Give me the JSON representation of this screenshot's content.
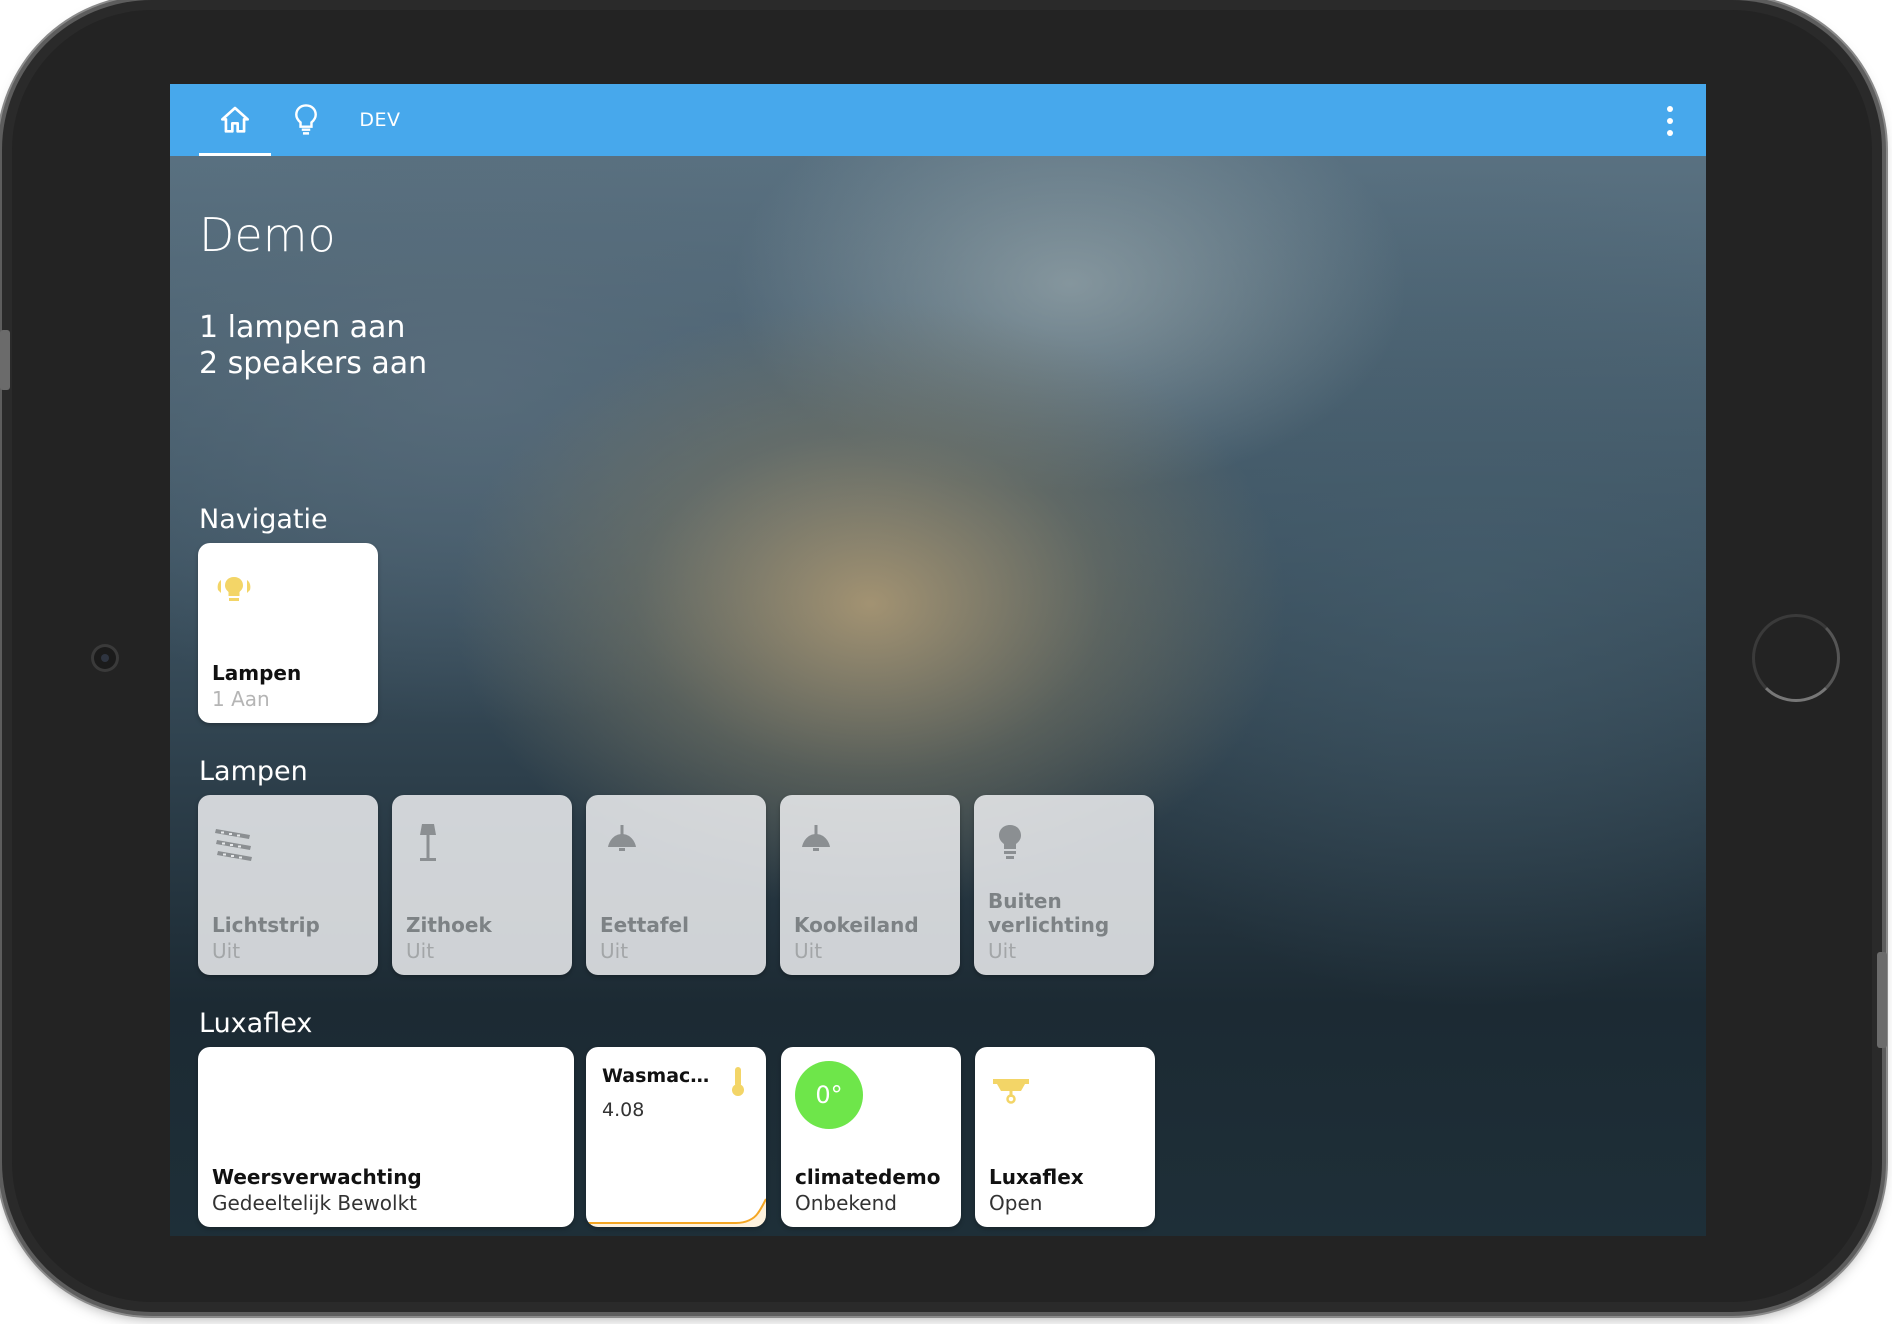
{
  "header": {
    "tabs": [
      {
        "icon": "home-icon",
        "active": true
      },
      {
        "icon": "lightbulb-icon",
        "active": false
      },
      {
        "label": "DEV",
        "active": false
      }
    ],
    "menu_icon": "kebab-menu-icon",
    "accent_color": "#47a8ec"
  },
  "page": {
    "title": "Demo",
    "summary": [
      "1 lampen aan",
      "2 speakers aan"
    ]
  },
  "sections": {
    "navigatie": {
      "title": "Navigatie",
      "cards": [
        {
          "name": "Lampen",
          "state": "1 Aan",
          "icon": "lightbulb-group-icon",
          "icon_color": "#f3d567"
        }
      ]
    },
    "lampen": {
      "title": "Lampen",
      "cards": [
        {
          "name": "Lichtstrip",
          "state": "Uit",
          "icon": "led-strip-icon"
        },
        {
          "name": "Zithoek",
          "state": "Uit",
          "icon": "floor-lamp-icon"
        },
        {
          "name": "Eettafel",
          "state": "Uit",
          "icon": "ceiling-light-icon"
        },
        {
          "name": "Kookeiland",
          "state": "Uit",
          "icon": "ceiling-light-icon"
        },
        {
          "name": "Buiten verlichting",
          "state": "Uit",
          "icon": "lightbulb-icon"
        }
      ]
    },
    "luxaflex": {
      "title": "Luxaflex",
      "weather": {
        "name": "Weersverwachting",
        "state": "Gedeeltelijk Bewolkt"
      },
      "sensor": {
        "name": "Wasmachine",
        "value": "4.08",
        "icon": "thermometer-icon",
        "graph_color": "#f5a623"
      },
      "climate": {
        "name": "climatedemo",
        "state": "Onbekend",
        "temp": "0°",
        "bubble_color": "#6ee64a"
      },
      "cover": {
        "name": "Luxaflex",
        "state": "Open",
        "icon": "window-shade-icon",
        "icon_color": "#f3d567"
      }
    }
  }
}
